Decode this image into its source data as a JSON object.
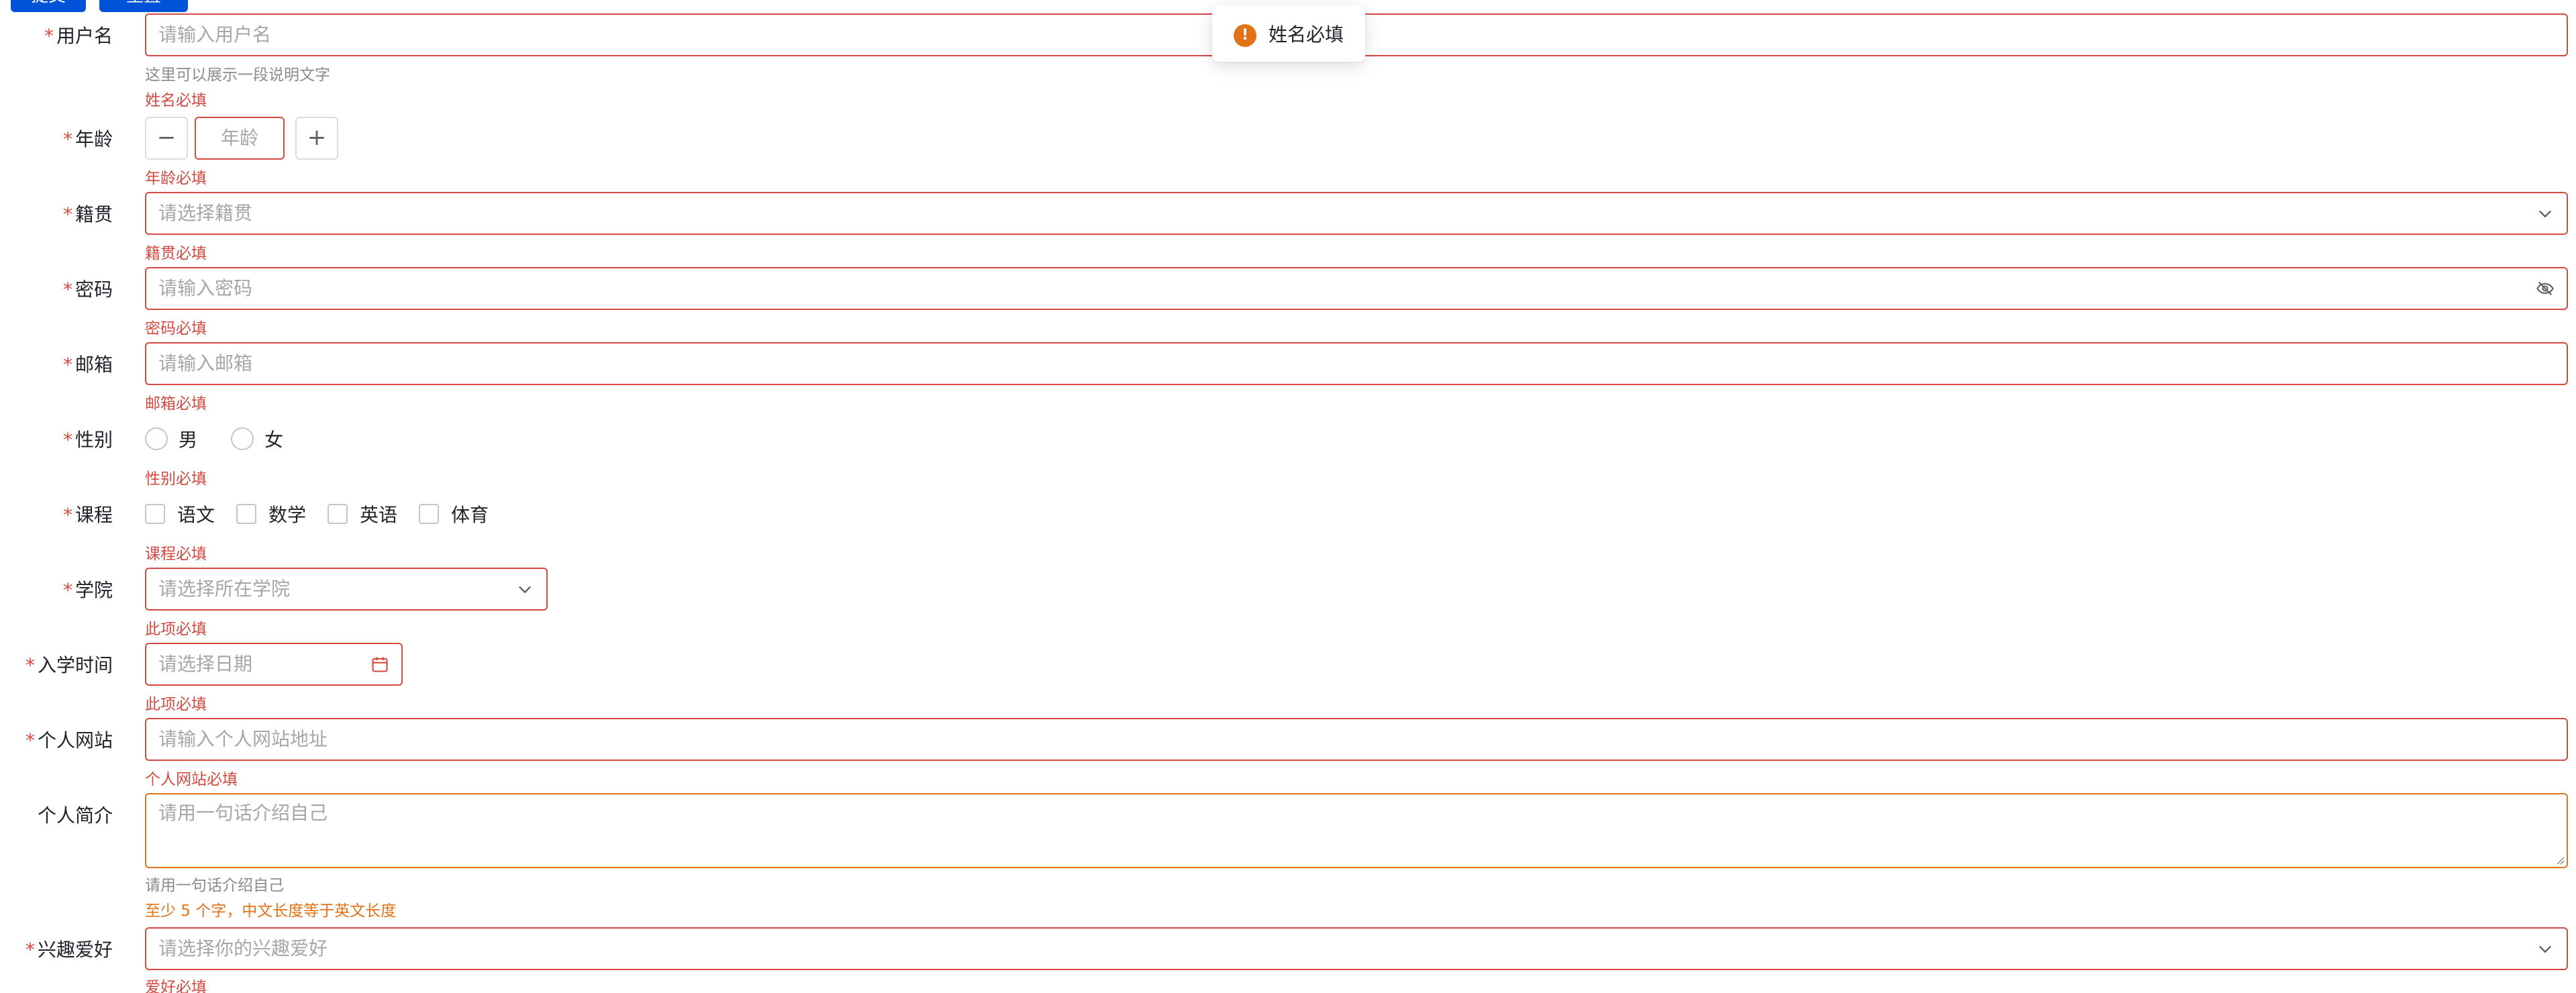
{
  "top_buttons": [
    "提交",
    "重置"
  ],
  "toast": {
    "icon": "warning-icon",
    "text": "姓名必填"
  },
  "colors": {
    "error": "#d54941",
    "warning": "#e37318",
    "primary": "#0052d9"
  },
  "required_mark": "*",
  "form": {
    "username": {
      "label": "用户名",
      "placeholder": "请输入用户名",
      "tip": "这里可以展示一段说明文字",
      "error": "姓名必填"
    },
    "age": {
      "label": "年龄",
      "placeholder": "年龄",
      "minus": "−",
      "plus": "+",
      "error": "年龄必填"
    },
    "hometown": {
      "label": "籍贯",
      "placeholder": "请选择籍贯",
      "error": "籍贯必填"
    },
    "password": {
      "label": "密码",
      "placeholder": "请输入密码",
      "error": "密码必填"
    },
    "email": {
      "label": "邮箱",
      "placeholder": "请输入邮箱",
      "error": "邮箱必填"
    },
    "gender": {
      "label": "性别",
      "options": [
        "男",
        "女"
      ],
      "error": "性别必填"
    },
    "course": {
      "label": "课程",
      "options": [
        "语文",
        "数学",
        "英语",
        "体育"
      ],
      "error": "课程必填"
    },
    "college": {
      "label": "学院",
      "placeholder": "请选择所在学院",
      "error": "此项必填"
    },
    "enroll_date": {
      "label": "入学时间",
      "placeholder": "请选择日期",
      "error": "此项必填"
    },
    "website": {
      "label": "个人网站",
      "placeholder": "请输入个人网站地址",
      "error": "个人网站必填"
    },
    "intro": {
      "label": "个人简介",
      "placeholder": "请用一句话介绍自己",
      "tip": "请用一句话介绍自己",
      "error": "至少 5 个字，中文长度等于英文长度"
    },
    "hobby": {
      "label": "兴趣爱好",
      "placeholder": "请选择你的兴趣爱好",
      "error": "爱好必填"
    }
  }
}
